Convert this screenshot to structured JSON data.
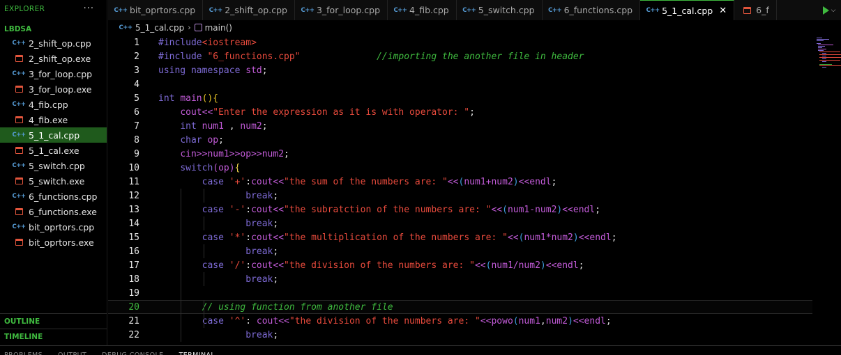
{
  "explorer": {
    "title": "EXPLORER",
    "more": "···",
    "folder": "LBDSA",
    "files": [
      {
        "name": "2_shift_op.cpp",
        "type": "cpp"
      },
      {
        "name": "2_shift_op.exe",
        "type": "exe"
      },
      {
        "name": "3_for_loop.cpp",
        "type": "cpp"
      },
      {
        "name": "3_for_loop.exe",
        "type": "exe"
      },
      {
        "name": "4_fib.cpp",
        "type": "cpp"
      },
      {
        "name": "4_fib.exe",
        "type": "exe"
      },
      {
        "name": "5_1_cal.cpp",
        "type": "cpp",
        "active": true
      },
      {
        "name": "5_1_cal.exe",
        "type": "exe"
      },
      {
        "name": "5_switch.cpp",
        "type": "cpp"
      },
      {
        "name": "5_switch.exe",
        "type": "exe"
      },
      {
        "name": "6_functions.cpp",
        "type": "cpp"
      },
      {
        "name": "6_functions.exe",
        "type": "exe"
      },
      {
        "name": "bit_oprtors.cpp",
        "type": "cpp"
      },
      {
        "name": "bit_oprtors.exe",
        "type": "exe"
      }
    ],
    "outline": "OUTLINE",
    "timeline": "TIMELINE"
  },
  "icons": {
    "cpp": "C++",
    "cpp_icon_name": "cpp-file-icon",
    "exe_icon_name": "exe-file-icon"
  },
  "tabs": [
    {
      "label": "bit_oprtors.cpp",
      "type": "cpp"
    },
    {
      "label": "2_shift_op.cpp",
      "type": "cpp"
    },
    {
      "label": "3_for_loop.cpp",
      "type": "cpp"
    },
    {
      "label": "4_fib.cpp",
      "type": "cpp"
    },
    {
      "label": "5_switch.cpp",
      "type": "cpp"
    },
    {
      "label": "6_functions.cpp",
      "type": "cpp"
    },
    {
      "label": "5_1_cal.cpp",
      "type": "cpp",
      "active": true,
      "close": "✕"
    },
    {
      "label": "6_f",
      "type": "exe"
    }
  ],
  "breadcrumb": {
    "file": "5_1_cal.cpp",
    "separator": "›",
    "symbol": "main()"
  },
  "editor": {
    "current_line": 20,
    "lines": [
      {
        "n": "1",
        "t": [
          [
            "pp",
            "#include"
          ],
          [
            "hdr",
            "<iostream>"
          ]
        ]
      },
      {
        "n": "2",
        "t": [
          [
            "pp",
            "#include "
          ],
          [
            "str",
            "\"6_functions.cpp\""
          ],
          [
            "pl",
            "              "
          ],
          [
            "cm",
            "//importing the another file in header"
          ]
        ]
      },
      {
        "n": "3",
        "t": [
          [
            "kw",
            "using namespace "
          ],
          [
            "id",
            "std"
          ],
          [
            "pl",
            ";"
          ]
        ]
      },
      {
        "n": "4",
        "t": []
      },
      {
        "n": "5",
        "t": [
          [
            "kw",
            "int "
          ],
          [
            "fn",
            "main"
          ],
          [
            "br1",
            "()"
          ],
          [
            "br1",
            "{"
          ]
        ]
      },
      {
        "n": "6",
        "t": [
          [
            "pl",
            "    "
          ],
          [
            "id",
            "cout"
          ],
          [
            "op",
            "<<"
          ],
          [
            "str",
            "\"Enter the expression as it is with operator: \""
          ],
          [
            "pl",
            ";"
          ]
        ]
      },
      {
        "n": "7",
        "t": [
          [
            "pl",
            "    "
          ],
          [
            "kw",
            "int "
          ],
          [
            "id",
            "num1"
          ],
          [
            "pl",
            " , "
          ],
          [
            "id",
            "num2"
          ],
          [
            "pl",
            ";"
          ]
        ]
      },
      {
        "n": "8",
        "t": [
          [
            "pl",
            "    "
          ],
          [
            "kw",
            "char "
          ],
          [
            "id",
            "op"
          ],
          [
            "pl",
            ";"
          ]
        ]
      },
      {
        "n": "9",
        "t": [
          [
            "pl",
            "    "
          ],
          [
            "id",
            "cin"
          ],
          [
            "op",
            ">>"
          ],
          [
            "id",
            "num1"
          ],
          [
            "op",
            ">>"
          ],
          [
            "id",
            "op"
          ],
          [
            "op",
            ">>"
          ],
          [
            "id",
            "num2"
          ],
          [
            "pl",
            ";"
          ]
        ]
      },
      {
        "n": "10",
        "t": [
          [
            "pl",
            "    "
          ],
          [
            "kw",
            "switch"
          ],
          [
            "br2",
            "("
          ],
          [
            "id",
            "op"
          ],
          [
            "br2",
            ")"
          ],
          [
            "yel",
            "{"
          ]
        ]
      },
      {
        "n": "11",
        "t": [
          [
            "pl",
            "        "
          ],
          [
            "kw",
            "case "
          ],
          [
            "str",
            "'+'"
          ],
          [
            "pl",
            ":"
          ],
          [
            "id",
            "cout"
          ],
          [
            "op",
            "<<"
          ],
          [
            "str",
            "\"the sum of the numbers are: \""
          ],
          [
            "op",
            "<<"
          ],
          [
            "br3",
            "("
          ],
          [
            "id",
            "num1"
          ],
          [
            "op",
            "+"
          ],
          [
            "id",
            "num2"
          ],
          [
            "br3",
            ")"
          ],
          [
            "op",
            "<<"
          ],
          [
            "id",
            "endl"
          ],
          [
            "pl",
            ";"
          ]
        ]
      },
      {
        "n": "12",
        "t": [
          [
            "pl",
            "                "
          ],
          [
            "kw",
            "break"
          ],
          [
            "pl",
            ";"
          ]
        ]
      },
      {
        "n": "13",
        "t": [
          [
            "pl",
            "        "
          ],
          [
            "kw",
            "case "
          ],
          [
            "str",
            "'-'"
          ],
          [
            "pl",
            ":"
          ],
          [
            "id",
            "cout"
          ],
          [
            "op",
            "<<"
          ],
          [
            "str",
            "\"the subratction of the numbers are: \""
          ],
          [
            "op",
            "<<"
          ],
          [
            "br3",
            "("
          ],
          [
            "id",
            "num1"
          ],
          [
            "op",
            "-"
          ],
          [
            "id",
            "num2"
          ],
          [
            "br3",
            ")"
          ],
          [
            "op",
            "<<"
          ],
          [
            "id",
            "endl"
          ],
          [
            "pl",
            ";"
          ]
        ]
      },
      {
        "n": "14",
        "t": [
          [
            "pl",
            "                "
          ],
          [
            "kw",
            "break"
          ],
          [
            "pl",
            ";"
          ]
        ]
      },
      {
        "n": "15",
        "t": [
          [
            "pl",
            "        "
          ],
          [
            "kw",
            "case "
          ],
          [
            "str",
            "'*'"
          ],
          [
            "pl",
            ":"
          ],
          [
            "id",
            "cout"
          ],
          [
            "op",
            "<<"
          ],
          [
            "str",
            "\"the multiplication of the numbers are: \""
          ],
          [
            "op",
            "<<"
          ],
          [
            "br3",
            "("
          ],
          [
            "id",
            "num1"
          ],
          [
            "op",
            "*"
          ],
          [
            "id",
            "num2"
          ],
          [
            "br3",
            ")"
          ],
          [
            "op",
            "<<"
          ],
          [
            "id",
            "endl"
          ],
          [
            "pl",
            ";"
          ]
        ]
      },
      {
        "n": "16",
        "t": [
          [
            "pl",
            "                "
          ],
          [
            "kw",
            "break"
          ],
          [
            "pl",
            ";"
          ]
        ]
      },
      {
        "n": "17",
        "t": [
          [
            "pl",
            "        "
          ],
          [
            "kw",
            "case "
          ],
          [
            "str",
            "'/'"
          ],
          [
            "pl",
            ":"
          ],
          [
            "id",
            "cout"
          ],
          [
            "op",
            "<<"
          ],
          [
            "str",
            "\"the division of the numbers are: \""
          ],
          [
            "op",
            "<<"
          ],
          [
            "br3",
            "("
          ],
          [
            "id",
            "num1"
          ],
          [
            "op",
            "/"
          ],
          [
            "id",
            "num2"
          ],
          [
            "br3",
            ")"
          ],
          [
            "op",
            "<<"
          ],
          [
            "id",
            "endl"
          ],
          [
            "pl",
            ";"
          ]
        ]
      },
      {
        "n": "18",
        "t": [
          [
            "pl",
            "                "
          ],
          [
            "kw",
            "break"
          ],
          [
            "pl",
            ";"
          ]
        ]
      },
      {
        "n": "19",
        "t": []
      },
      {
        "n": "20",
        "t": [
          [
            "pl",
            "        "
          ],
          [
            "cm",
            "// using function from another file"
          ]
        ]
      },
      {
        "n": "21",
        "t": [
          [
            "pl",
            "        "
          ],
          [
            "kw",
            "case "
          ],
          [
            "str",
            "'^'"
          ],
          [
            "pl",
            ": "
          ],
          [
            "id",
            "cout"
          ],
          [
            "op",
            "<<"
          ],
          [
            "str",
            "\"the division of the numbers are: \""
          ],
          [
            "op",
            "<<"
          ],
          [
            "fn",
            "powo"
          ],
          [
            "br3",
            "("
          ],
          [
            "id",
            "num1"
          ],
          [
            "pl",
            ","
          ],
          [
            "id",
            "num2"
          ],
          [
            "br3",
            ")"
          ],
          [
            "op",
            "<<"
          ],
          [
            "id",
            "endl"
          ],
          [
            "pl",
            ";"
          ]
        ]
      },
      {
        "n": "22",
        "t": [
          [
            "pl",
            "                "
          ],
          [
            "kw",
            "break"
          ],
          [
            "pl",
            ";"
          ]
        ]
      }
    ]
  },
  "panel_tabs": [
    "PROBLEMS",
    "OUTPUT",
    "DEBUG CONSOLE",
    "TERMINAL"
  ],
  "panel_active": "TERMINAL"
}
